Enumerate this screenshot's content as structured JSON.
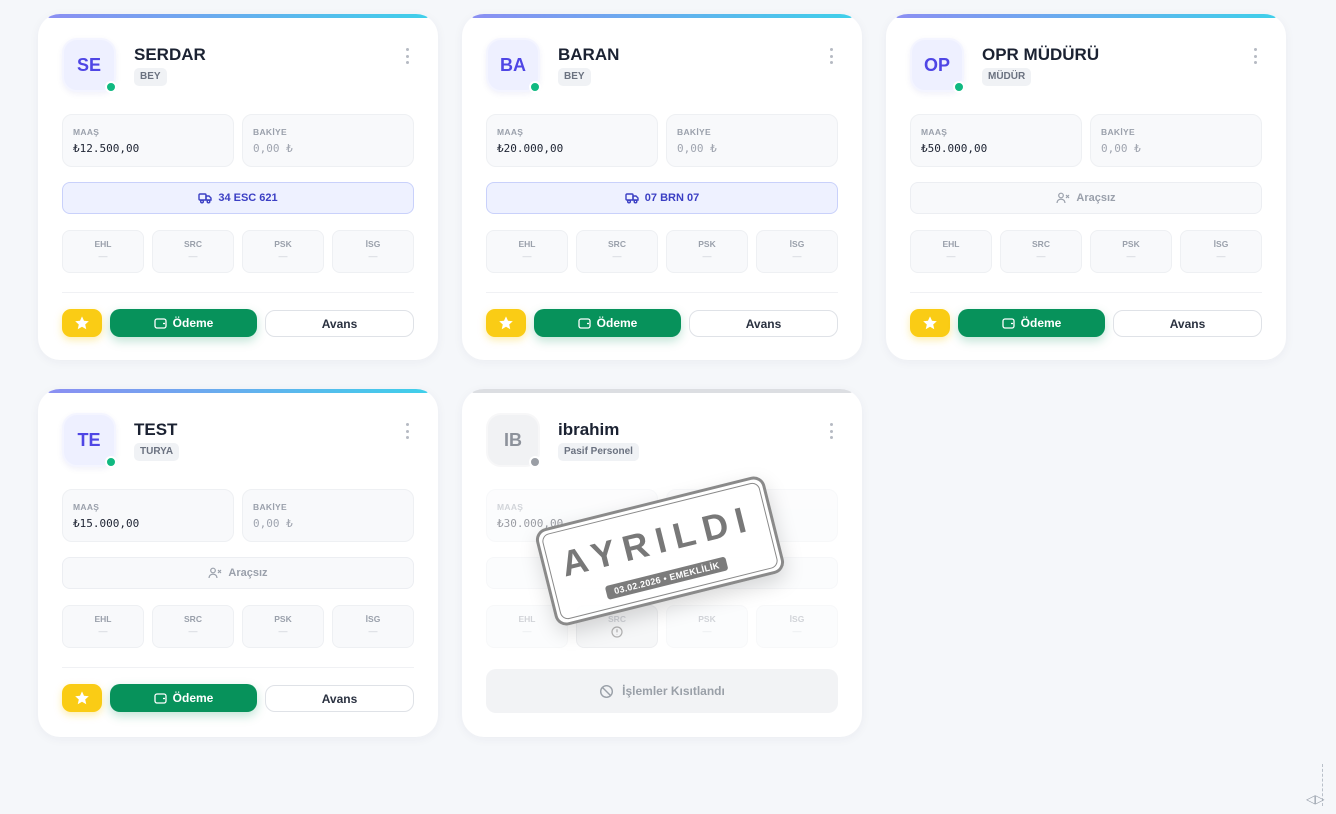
{
  "cards": [
    {
      "initials": "SE",
      "name": "SERDAR",
      "role": "BEY",
      "salary_label": "MAAŞ",
      "salary": "₺12.500,00",
      "balance_label": "BAKİYE",
      "balance": "0,00 ₺",
      "vehicle": "34 ESC 621",
      "docs": [
        {
          "label": "EHL",
          "value": "—"
        },
        {
          "label": "SRC",
          "value": "—"
        },
        {
          "label": "PSK",
          "value": "—"
        },
        {
          "label": "İSG",
          "value": "—"
        }
      ],
      "pay_label": "Ödeme",
      "advance_label": "Avans"
    },
    {
      "initials": "BA",
      "name": "BARAN",
      "role": "BEY",
      "salary_label": "MAAŞ",
      "salary": "₺20.000,00",
      "balance_label": "BAKİYE",
      "balance": "0,00 ₺",
      "vehicle": "07 BRN 07",
      "docs": [
        {
          "label": "EHL",
          "value": "—"
        },
        {
          "label": "SRC",
          "value": "—"
        },
        {
          "label": "PSK",
          "value": "—"
        },
        {
          "label": "İSG",
          "value": "—"
        }
      ],
      "pay_label": "Ödeme",
      "advance_label": "Avans"
    },
    {
      "initials": "OP",
      "name": "OPR MÜDÜRÜ",
      "role": "MÜDÜR",
      "salary_label": "MAAŞ",
      "salary": "₺50.000,00",
      "balance_label": "BAKİYE",
      "balance": "0,00 ₺",
      "vehicle": "Araçsız",
      "docs": [
        {
          "label": "EHL",
          "value": "—"
        },
        {
          "label": "SRC",
          "value": "—"
        },
        {
          "label": "PSK",
          "value": "—"
        },
        {
          "label": "İSG",
          "value": "—"
        }
      ],
      "pay_label": "Ödeme",
      "advance_label": "Avans"
    },
    {
      "initials": "TE",
      "name": "TEST",
      "role": "TURYA",
      "salary_label": "MAAŞ",
      "salary": "₺15.000,00",
      "balance_label": "BAKİYE",
      "balance": "0,00 ₺",
      "vehicle": "Araçsız",
      "docs": [
        {
          "label": "EHL",
          "value": "—"
        },
        {
          "label": "SRC",
          "value": "—"
        },
        {
          "label": "PSK",
          "value": "—"
        },
        {
          "label": "İSG",
          "value": "—"
        }
      ],
      "pay_label": "Ödeme",
      "advance_label": "Avans"
    },
    {
      "initials": "IB",
      "name": "ibrahim",
      "role": "Pasif Personel",
      "salary_label": "MAAŞ",
      "salary": "₺30.000,00",
      "docs": [
        {
          "label": "EHL",
          "value": "—"
        },
        {
          "label": "SRC",
          "value": ""
        },
        {
          "label": "PSK",
          "value": "—"
        },
        {
          "label": "İSG",
          "value": "—"
        }
      ],
      "restricted_label": "İşlemler Kısıtlandı",
      "stamp_title": "AYRILDI",
      "stamp_sub": "03.02.2026 • EMEKLİLİK"
    }
  ],
  "colors": {
    "accent": "#4f46e5",
    "pay": "#07925b",
    "star": "#facc15",
    "online": "#10b981"
  }
}
